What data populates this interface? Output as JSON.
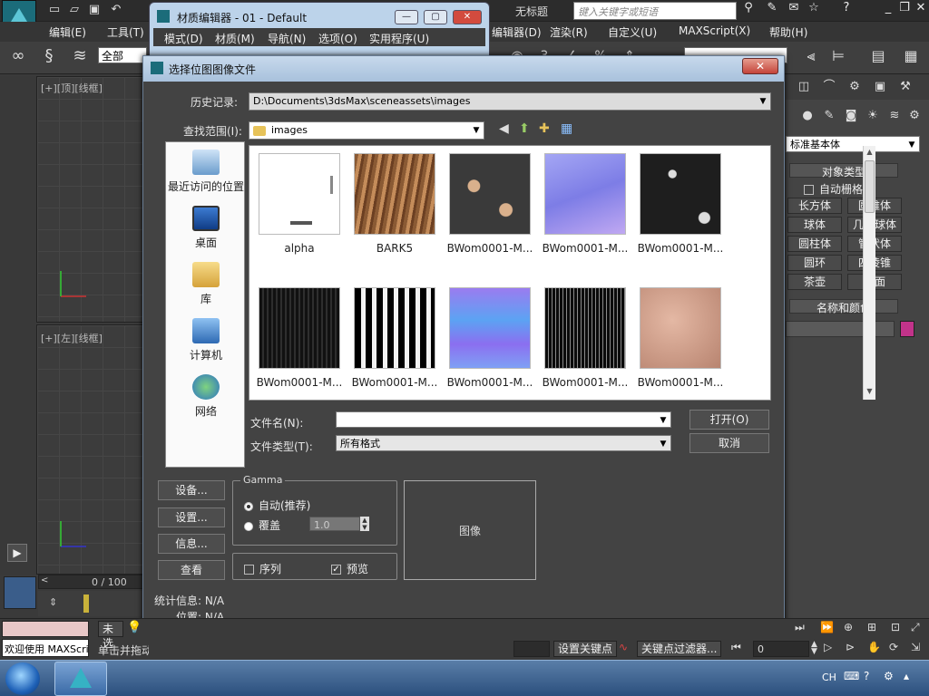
{
  "app": {
    "untitled": "无标题",
    "search_placeholder": "键入关键字或短语",
    "menu": [
      "编辑(E)",
      "工具(T)"
    ],
    "menu_right": [
      "编辑器(D)",
      "渲染(R)",
      "自定义(U)",
      "MAXScript(X)",
      "帮助(H)"
    ],
    "selection_filter": "全部",
    "viewport_top_label": "[+][顶][线框]",
    "viewport_left_label": "[+][左][线框]",
    "timeline": "0 / 100"
  },
  "material_editor": {
    "title": "材质编辑器 - 01 - Default",
    "menu": [
      "模式(D)",
      "材质(M)",
      "导航(N)",
      "选项(O)",
      "实用程序(U)"
    ]
  },
  "command_panel": {
    "category": "标准基本体",
    "object_type_title": "对象类型",
    "autogrid_label": "自动栅格",
    "objects": [
      "长方体",
      "圆锥体",
      "球体",
      "几何球体",
      "圆柱体",
      "管状体",
      "圆环",
      "四棱锥",
      "茶壶",
      "平面"
    ],
    "name_color_title": "名称和颜色",
    "color": "#c2338a"
  },
  "dialog": {
    "title": "选择位图图像文件",
    "history_label": "历史记录:",
    "history_value": "D:\\Documents\\3dsMax\\sceneassets\\images",
    "lookin_label": "查找范围(I):",
    "lookin_value": "images",
    "places": [
      "最近访问的位置",
      "桌面",
      "库",
      "计算机",
      "网络"
    ],
    "files": [
      "alpha",
      "BARK5",
      "BWom0001-M...",
      "BWom0001-M...",
      "BWom0001-M...",
      "BWom0001-M...",
      "BWom0001-M...",
      "BWom0001-M...",
      "BWom0001-M...",
      "BWom0001-M..."
    ],
    "filename_label": "文件名(N):",
    "filename_value": "",
    "filetype_label": "文件类型(T):",
    "filetype_value": "所有格式",
    "open_button": "打开(O)",
    "cancel_button": "取消",
    "setup_button": "设备...",
    "settings_button": "设置...",
    "info_button": "信息...",
    "view_button": "查看",
    "gamma_title": "Gamma",
    "gamma_auto": "自动(推荐)",
    "gamma_override": "覆盖",
    "gamma_value": "1.0",
    "sequence_label": "序列",
    "preview_label": "预览",
    "image_label": "图像",
    "stats_label": "统计信息: N/A",
    "location_label": "位置: N/A"
  },
  "status": {
    "welcome": "欢迎使用 MAXScri",
    "unselected": "未选",
    "click_drag": "单击并拖动",
    "set_key": "设置关键点",
    "key_filters": "关键点过滤器...",
    "frame_value": "0"
  },
  "taskbar": {
    "lang": "CH"
  }
}
